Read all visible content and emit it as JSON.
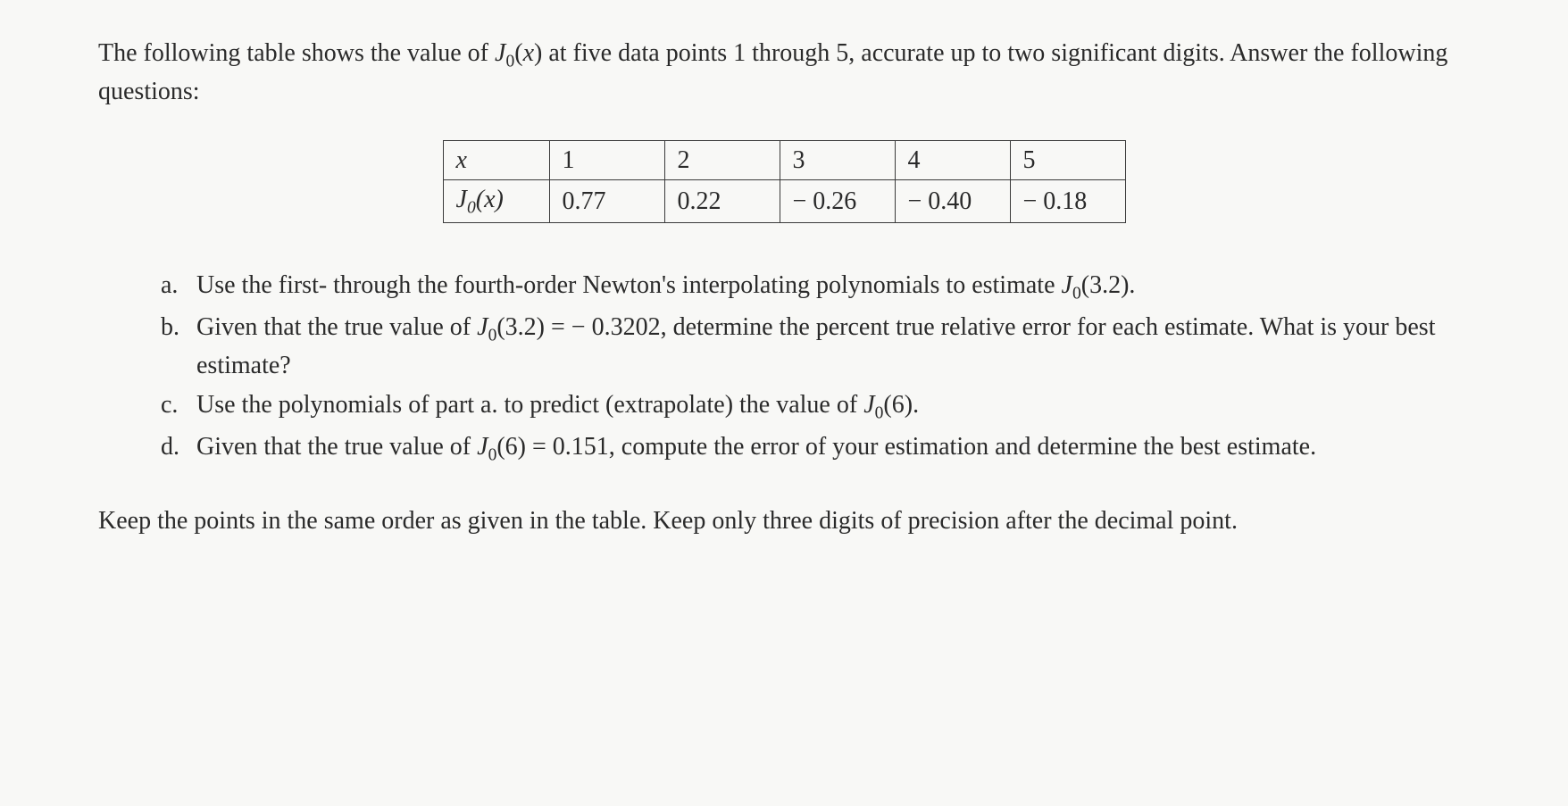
{
  "intro": "The following table shows the value of J₀(x) at five data points 1 through 5, accurate up to two significant digits. Answer the following questions:",
  "table": {
    "row1_label": "x",
    "row1": [
      "1",
      "2",
      "3",
      "4",
      "5"
    ],
    "row2_label_html": "J₀(x)",
    "row2": [
      "0.77",
      "0.22",
      "− 0.26",
      "− 0.40",
      "− 0.18"
    ]
  },
  "questions": [
    {
      "marker": "a.",
      "text": "Use the first- through the fourth-order Newton's interpolating polynomials to estimate J₀(3.2)."
    },
    {
      "marker": "b.",
      "text": "Given that the true value of J₀(3.2) = − 0.3202, determine the percent true relative error for each estimate. What is your best estimate?"
    },
    {
      "marker": "c.",
      "text": "Use the polynomials of part a. to predict (extrapolate) the value of J₀(6)."
    },
    {
      "marker": "d.",
      "text": "Given that the true value of J₀(6) = 0.151, compute the error of your estimation and determine the best estimate."
    }
  ],
  "footer": "Keep the points in the same order as given in the table. Keep only three digits of precision after the decimal point.",
  "chart_data": {
    "type": "table",
    "title": "Values of J0(x)",
    "x": [
      1,
      2,
      3,
      4,
      5
    ],
    "J0_x": [
      0.77,
      0.22,
      -0.26,
      -0.4,
      -0.18
    ]
  }
}
